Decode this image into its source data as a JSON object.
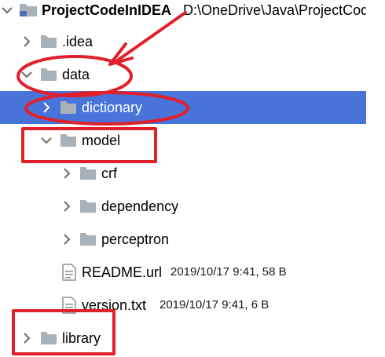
{
  "tree": {
    "root": {
      "name": "ProjectCodeInIDEA",
      "path": "D:\\OneDrive\\Java\\ProjectCod"
    },
    "items": [
      {
        "label": ".idea"
      },
      {
        "label": "data"
      },
      {
        "label": "dictionary"
      },
      {
        "label": "model"
      },
      {
        "label": "crf"
      },
      {
        "label": "dependency"
      },
      {
        "label": "perceptron"
      },
      {
        "label": "README.url",
        "meta": "2019/10/17 9:41, 58 B"
      },
      {
        "label": "version.txt",
        "meta": "2019/10/17 9:41, 6 B"
      },
      {
        "label": "library"
      }
    ]
  },
  "colors": {
    "selection": "#4874d9",
    "annotation": "#e0202a",
    "folder": "#a9b1b8"
  },
  "icons": {
    "expanded": "chevron-down-icon",
    "collapsed": "chevron-right-icon",
    "folder": "folder-icon",
    "file": "file-icon"
  }
}
